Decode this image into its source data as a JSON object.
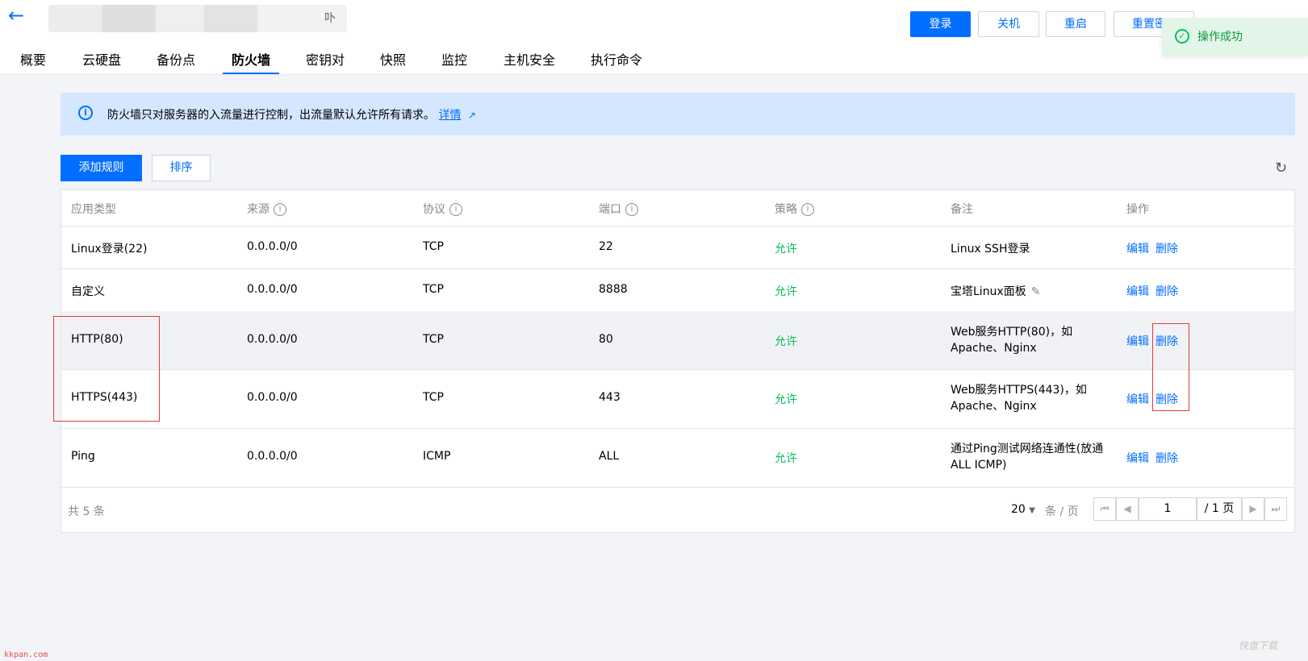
{
  "header": {
    "back_icon": "arrow-left-icon",
    "partial_title": "卟",
    "tabs": [
      "概要",
      "云硬盘",
      "备份点",
      "防火墙",
      "密钥对",
      "快照",
      "监控",
      "主机安全",
      "执行命令"
    ],
    "active_tab": "防火墙",
    "buttons": {
      "login": "登录",
      "shutdown": "关机",
      "restart": "重启",
      "reset": "重置密"
    }
  },
  "toast": {
    "icon": "check-circle-icon",
    "text": "操作成功",
    "color": "#0abf5b"
  },
  "notice": {
    "icon": "info-icon",
    "text": "防火墙只对服务器的入流量进行控制，出流量默认允许所有请求。",
    "link": "详情",
    "link_icon": "external-link-icon"
  },
  "toolbar": {
    "add_rule": "添加规则",
    "sort": "排序",
    "refresh_icon": "refresh-icon"
  },
  "table": {
    "columns": [
      "应用类型",
      "来源",
      "协议",
      "端口",
      "策略",
      "备注",
      "操作"
    ],
    "rows": [
      {
        "type": "Linux登录(22)",
        "source": "0.0.0.0/0",
        "protocol": "TCP",
        "port": "22",
        "policy": "允许",
        "remark": "Linux SSH登录",
        "edit": "编辑",
        "delete": "删除"
      },
      {
        "type": "自定义",
        "source": "0.0.0.0/0",
        "protocol": "TCP",
        "port": "8888",
        "policy": "允许",
        "remark": "宝塔Linux面板",
        "edit": "编辑",
        "delete": "删除"
      },
      {
        "type": "HTTP(80)",
        "source": "0.0.0.0/0",
        "protocol": "TCP",
        "port": "80",
        "policy": "允许",
        "remark": "Web服务HTTP(80)，如",
        "remark2": "Apache、Nginx",
        "edit": "编辑",
        "delete": "删除"
      },
      {
        "type": "HTTPS(443)",
        "source": "0.0.0.0/0",
        "protocol": "TCP",
        "port": "443",
        "policy": "允许",
        "remark": "Web服务HTTPS(443)，如",
        "remark2": "Apache、Nginx",
        "edit": "编辑",
        "delete": "删除"
      },
      {
        "type": "Ping",
        "source": "0.0.0.0/0",
        "protocol": "ICMP",
        "port": "ALL",
        "policy": "允许",
        "remark": "通过Ping测试网络连通性(放通",
        "remark2": "ALL ICMP)",
        "edit": "编辑",
        "delete": "删除"
      }
    ],
    "total": "共 5 条",
    "page_size": "20",
    "page_size_unit": "条 / 页",
    "current_page": "1",
    "total_pages": "/ 1 页"
  },
  "watermarks": {
    "left": "kkpan.com",
    "right": "快盘下载"
  },
  "colors": {
    "accent": "#006eff",
    "allow": "#0abf5b",
    "notice_bg": "#d5e7ff",
    "highlight_box": "#e23c3c"
  }
}
